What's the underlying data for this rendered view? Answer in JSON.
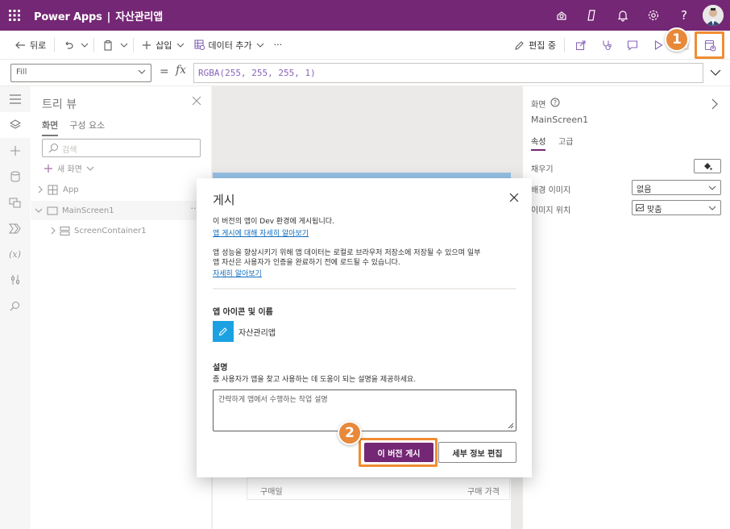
{
  "topbar": {
    "product": "Power Apps",
    "separator": "|",
    "app_name": "자산관리앱"
  },
  "commandbar": {
    "back_label": "뒤로",
    "insert_label": "삽입",
    "add_data_label": "데이터 추가",
    "more_label": "···",
    "editing_label": "편집 중"
  },
  "formulabar": {
    "property": "Fill",
    "equals": "=",
    "fx": "fx",
    "formula": "RGBA(255, 255, 255, 1)"
  },
  "tree": {
    "title": "트리 뷰",
    "tabs": [
      "화면",
      "구성 요소"
    ],
    "search_placeholder": "검색",
    "new_screen_label": "새 화면",
    "rows": [
      "App",
      "MainScreen1",
      "ScreenContainer1"
    ],
    "row_menu": "···"
  },
  "canvas": {
    "col_purchase_date": "구매일",
    "col_purchase_price": "구매 가격"
  },
  "rpanel": {
    "screen_label": "화면",
    "screen_name": "MainScreen1",
    "tabs": [
      "속성",
      "고급"
    ],
    "fill_label": "채우기",
    "bg_image_label": "배경 이미지",
    "bg_image_value": "없음",
    "image_pos_label": "이미지 위치",
    "image_pos_value": "맞춤"
  },
  "dialog": {
    "title": "게시",
    "line1": "이 버전의 앱이 Dev 환경에 게시됩니다.",
    "link1": "앱 게시에 대해 자세히 알아보기",
    "line2": "앱 성능을 향상시키기 위해 앱 데이터는 로컬로 브라우저 저장소에 저장될 수 있으며 일부",
    "line3": "앱 자산은 사용자가 인증을 완료하기 전에 로드될 수 있습니다.",
    "link2": "자세히 알아보기",
    "icon_section": "앱 아이콘 및 이름",
    "app_name": "자산관리앱",
    "desc_section": "설명",
    "desc_help": "좀 사용자가 앱을 찾고 사용하는 데 도움이 되는 설명을 제공하세요.",
    "desc_placeholder": "간략하게 앱에서 수행하는 작업 설명",
    "publish_button": "이 버전 게시",
    "edit_details_button": "세부 정보 편집"
  },
  "callouts": {
    "step1": "1",
    "step2": "2"
  },
  "colors": {
    "brand": "#742774",
    "callout": "#f08c32"
  }
}
